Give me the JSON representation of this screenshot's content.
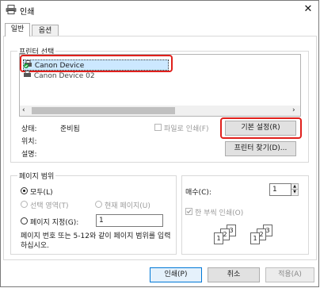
{
  "window": {
    "title": "인쇄"
  },
  "tabs": [
    {
      "label": "일반"
    },
    {
      "label": "옵션"
    }
  ],
  "printer_select": {
    "legend": "프린터 선택",
    "printers": [
      {
        "name": "Canon Device"
      },
      {
        "name": "Canon Device 02"
      }
    ]
  },
  "status": {
    "state_label": "상태:",
    "state_value": "준비됨",
    "location_label": "위치:",
    "location_value": "",
    "comment_label": "설명:",
    "comment_value": ""
  },
  "print_to_file_label": "파일로 인쇄(F)",
  "preferences_button": "기본 설정(R)",
  "find_printer_button": "프린터 찾기(D)...",
  "page_range": {
    "legend": "페이지 범위",
    "all_label": "모두(L)",
    "selection_label": "선택 영역(T)",
    "current_page_label": "현재 페이지(U)",
    "pages_label": "페이지 지정(G):",
    "pages_value": "1",
    "hint": "페이지 번호 또는 5-12와 같이 페이지 범위를 입력하십시오."
  },
  "copies": {
    "label": "매수(C):",
    "value": "1",
    "collate_label": "한 부씩 인쇄(O)",
    "collate_digits": [
      "1",
      "2",
      "3",
      "1",
      "2",
      "3"
    ]
  },
  "buttons": {
    "print": "인쇄(P)",
    "cancel": "취소",
    "apply": "적용(A)"
  },
  "icons": {
    "title": "printer-icon",
    "close": "close-icon",
    "printer_ready": "printer-ready-icon",
    "printer_generic": "printer-icon",
    "scroll_left": "chevron-left-icon",
    "scroll_right": "chevron-right-icon"
  }
}
